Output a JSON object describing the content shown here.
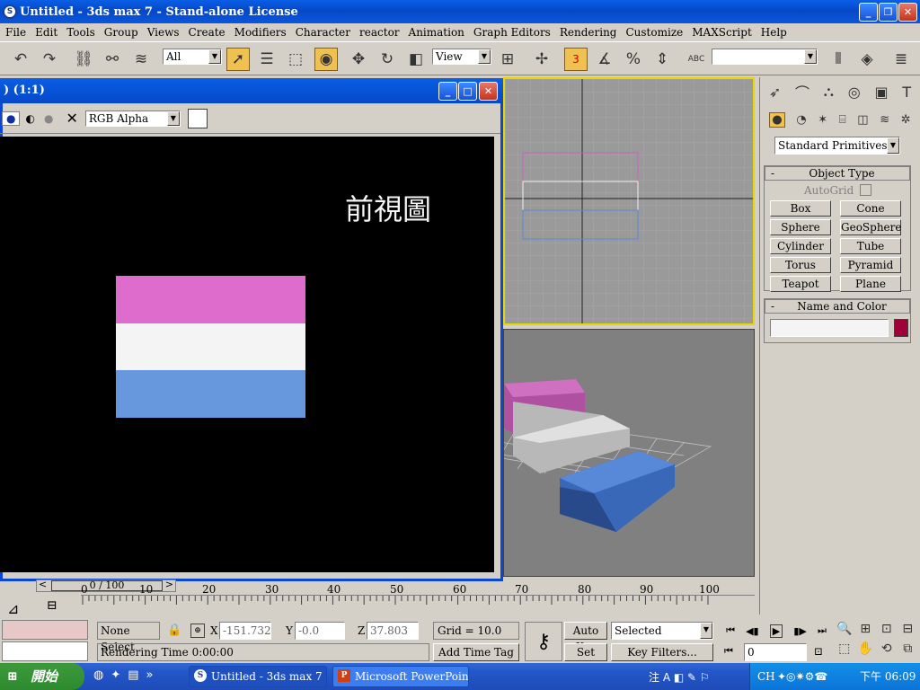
{
  "app": {
    "title": "Untitled - 3ds max 7  - Stand-alone License",
    "icon_letter": "S"
  },
  "menu": [
    "File",
    "Edit",
    "Tools",
    "Group",
    "Views",
    "Create",
    "Modifiers",
    "Character",
    "reactor",
    "Animation",
    "Graph Editors",
    "Rendering",
    "Customize",
    "MAXScript",
    "Help"
  ],
  "toolbar": {
    "selection_filter": "All",
    "ref_coord": "View",
    "snap_label": "3",
    "abc_label": "ABC",
    "named_sel": ""
  },
  "render_window": {
    "title": ") (1:1)",
    "channel": "RGB Alpha",
    "caption": "前視圖",
    "colors": {
      "top": "#dd6ccd",
      "middle": "#f4f4f4",
      "bottom": "#6797dd"
    }
  },
  "command_panel": {
    "category": "Standard Primitives",
    "object_type_header": "Object Type",
    "autogrid_label": "AutoGrid",
    "buttons": [
      "Box",
      "Cone",
      "Sphere",
      "GeoSphere",
      "Cylinder",
      "Tube",
      "Torus",
      "Pyramid",
      "Teapot",
      "Plane"
    ],
    "name_color_header": "Name and Color",
    "name_value": "",
    "object_color": "#a00038"
  },
  "timeline": {
    "slider_label": "0 / 100",
    "ticks": [
      "0",
      "10",
      "20",
      "30",
      "40",
      "50",
      "60",
      "70",
      "80",
      "90",
      "100"
    ]
  },
  "status": {
    "selection": "None Select",
    "x_label": "X",
    "x": "-151.732",
    "y_label": "Y",
    "y": "-0.0",
    "z_label": "Z",
    "z": "37.803",
    "grid": "Grid = 10.0",
    "prompt": "Rendering Time  0:00:00",
    "add_time_tag": "Add Time Tag",
    "auto_key": "Auto Key",
    "set_key": "Set Key",
    "key_mode": "Selected",
    "key_filters": "Key Filters...",
    "frame": "0"
  },
  "taskbar": {
    "start": "開始",
    "tasks": [
      "Untitled - 3ds max 7 -...",
      "Microsoft PowerPoint ..."
    ],
    "tray_lang": "CH",
    "clock": "下午 06:09"
  }
}
